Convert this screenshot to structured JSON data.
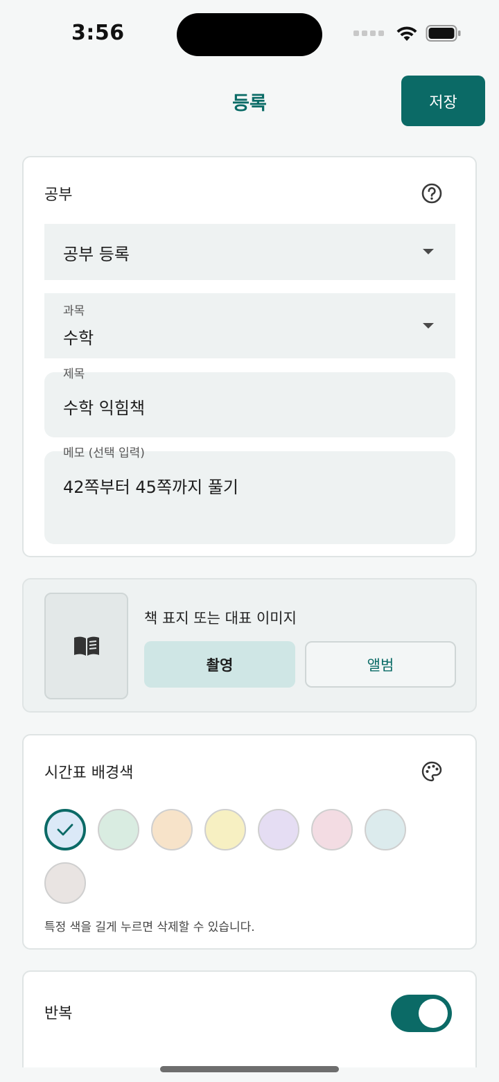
{
  "status": {
    "time": "3:56"
  },
  "header": {
    "title": "등록",
    "save_label": "저장"
  },
  "study": {
    "section_title": "공부",
    "type_value": "공부 등록",
    "subject_label": "과목",
    "subject_value": "수학",
    "title_label": "제목",
    "title_value": "수학 익힘책",
    "memo_label": "메모 (선택 입력)",
    "memo_value": "42쪽부터 45쪽까지 풀기"
  },
  "image_section": {
    "caption": "책 표지 또는 대표 이미지",
    "camera_label": "촬영",
    "album_label": "앨범"
  },
  "color_section": {
    "title": "시간표 배경색",
    "hint": "특정 색을 길게 누르면 삭제할 수 있습니다.",
    "selected_index": 0,
    "swatches": [
      "#dbe9f7",
      "#d9ece1",
      "#f7e3c9",
      "#f7f0c2",
      "#e5ddf3",
      "#f3dce3",
      "#dcebed",
      "#e9e4e2"
    ]
  },
  "repeat": {
    "label": "반복",
    "enabled": true
  },
  "colors": {
    "accent": "#0b6a66"
  }
}
